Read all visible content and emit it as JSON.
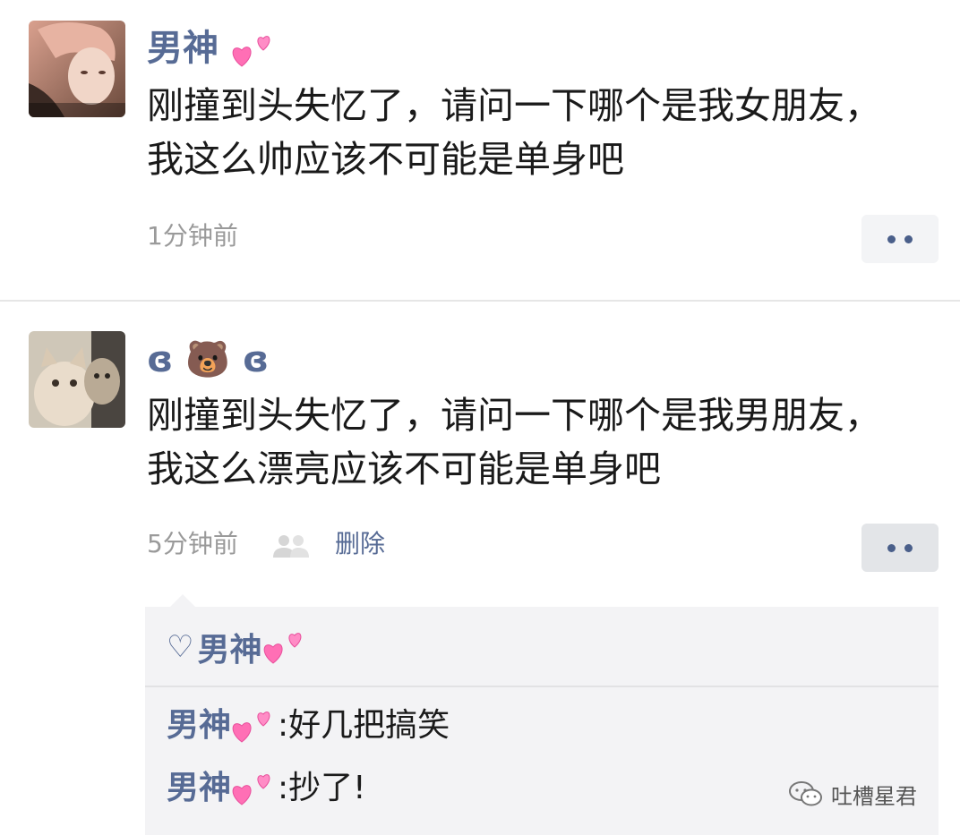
{
  "posts": [
    {
      "author": "男神",
      "content": "刚撞到头失忆了，请问一下哪个是我女朋友，我这么帅应该不可能是单身吧",
      "time": "1分钟前"
    },
    {
      "author": "ɞ 🐻 ɞ",
      "content": "刚撞到头失忆了，请问一下哪个是我男朋友，我这么漂亮应该不可能是单身吧",
      "time": "5分钟前",
      "delete_label": "删除",
      "likes": {
        "heart_symbol": "♡",
        "names": "男神"
      },
      "comments": [
        {
          "author": "男神",
          "separator": ":",
          "text": " 好几把搞笑"
        },
        {
          "author": "男神",
          "separator": ":",
          "text": " 抄了!"
        }
      ]
    }
  ],
  "watermark": {
    "text": "吐槽星君"
  },
  "icons": {
    "more": "more-dots-icon",
    "privacy": "two-person-icon",
    "hearts": "sparkling-hearts-emoji",
    "watermark": "wechat-logo-icon"
  },
  "colors": {
    "name_link": "#576b95",
    "meta_gray": "#9a9a9a",
    "comment_bg": "#f3f3f5",
    "heart_pink": "#ff6fb5"
  }
}
